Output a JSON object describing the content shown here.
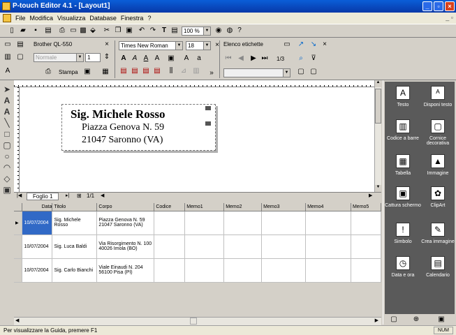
{
  "window": {
    "title": "P-touch Editor 4.1 - [Layout1]"
  },
  "menu": [
    "File",
    "Modifica",
    "Visualizza",
    "Database",
    "Finestra",
    "?"
  ],
  "toolbar": {
    "printer": "Brother QL-550",
    "style": "Normale",
    "copies": "1",
    "print_label": "Stampa",
    "font": "Times New Roman",
    "size": "18",
    "zoom": "100 %",
    "list_title": "Elenco etichette",
    "pager": "1/3"
  },
  "label": {
    "line1": "Sig. Michele Rosso",
    "line2": "Piazza Genova N. 59",
    "line3": "21047 Saronno (VA)"
  },
  "sheet": {
    "tab": "Foglio 1",
    "pages": "1/1"
  },
  "table": {
    "headers": [
      "Data",
      "Titolo",
      "Corpo",
      "Codice",
      "Memo1",
      "Memo2",
      "Memo3",
      "Memo4",
      "Memo5"
    ],
    "rows": [
      [
        "10/07/2004",
        "Sig. Michele Rosso",
        "Piazza Genova N. 59\n21047 Saronno (VA)",
        "",
        "",
        "",
        "",
        "",
        ""
      ],
      [
        "10/07/2004",
        "Sig. Luca Baldi",
        "Via Risorgimento N. 100\n40026 Imola (BO)",
        "",
        "",
        "",
        "",
        "",
        ""
      ],
      [
        "10/07/2004",
        "Sig. Carlo Bianchi",
        "Viale Einaudi N. 204\n56100 Pisa (PI)",
        "",
        "",
        "",
        "",
        "",
        ""
      ]
    ]
  },
  "panel": [
    {
      "label": "Testo",
      "icon": "text-icon",
      "glyph": "A"
    },
    {
      "label": "Disponi testo",
      "icon": "arrange-text-icon",
      "glyph": "ᴬ"
    },
    {
      "label": "Codice a barre",
      "icon": "barcode-icon",
      "glyph": "▥"
    },
    {
      "label": "Cornice decorativa",
      "icon": "frame-icon",
      "glyph": "▢"
    },
    {
      "label": "Tabella",
      "icon": "table-icon",
      "glyph": "▦"
    },
    {
      "label": "Immagine",
      "icon": "image-icon",
      "glyph": "▲"
    },
    {
      "label": "Cattura schermo",
      "icon": "screen-capture-icon",
      "glyph": "▣"
    },
    {
      "label": "ClipArt",
      "icon": "clipart-icon",
      "glyph": "✿"
    },
    {
      "label": "Simbolo",
      "icon": "symbol-icon",
      "glyph": "!"
    },
    {
      "label": "Crea immagine",
      "icon": "create-image-icon",
      "glyph": "✎"
    },
    {
      "label": "Data e ora",
      "icon": "clock-icon",
      "glyph": "◷"
    },
    {
      "label": "Calendario",
      "icon": "calendar-icon",
      "glyph": "▤"
    }
  ],
  "status": {
    "text": "Per visualizzare la Guida, premere F1",
    "num": "NUM"
  }
}
